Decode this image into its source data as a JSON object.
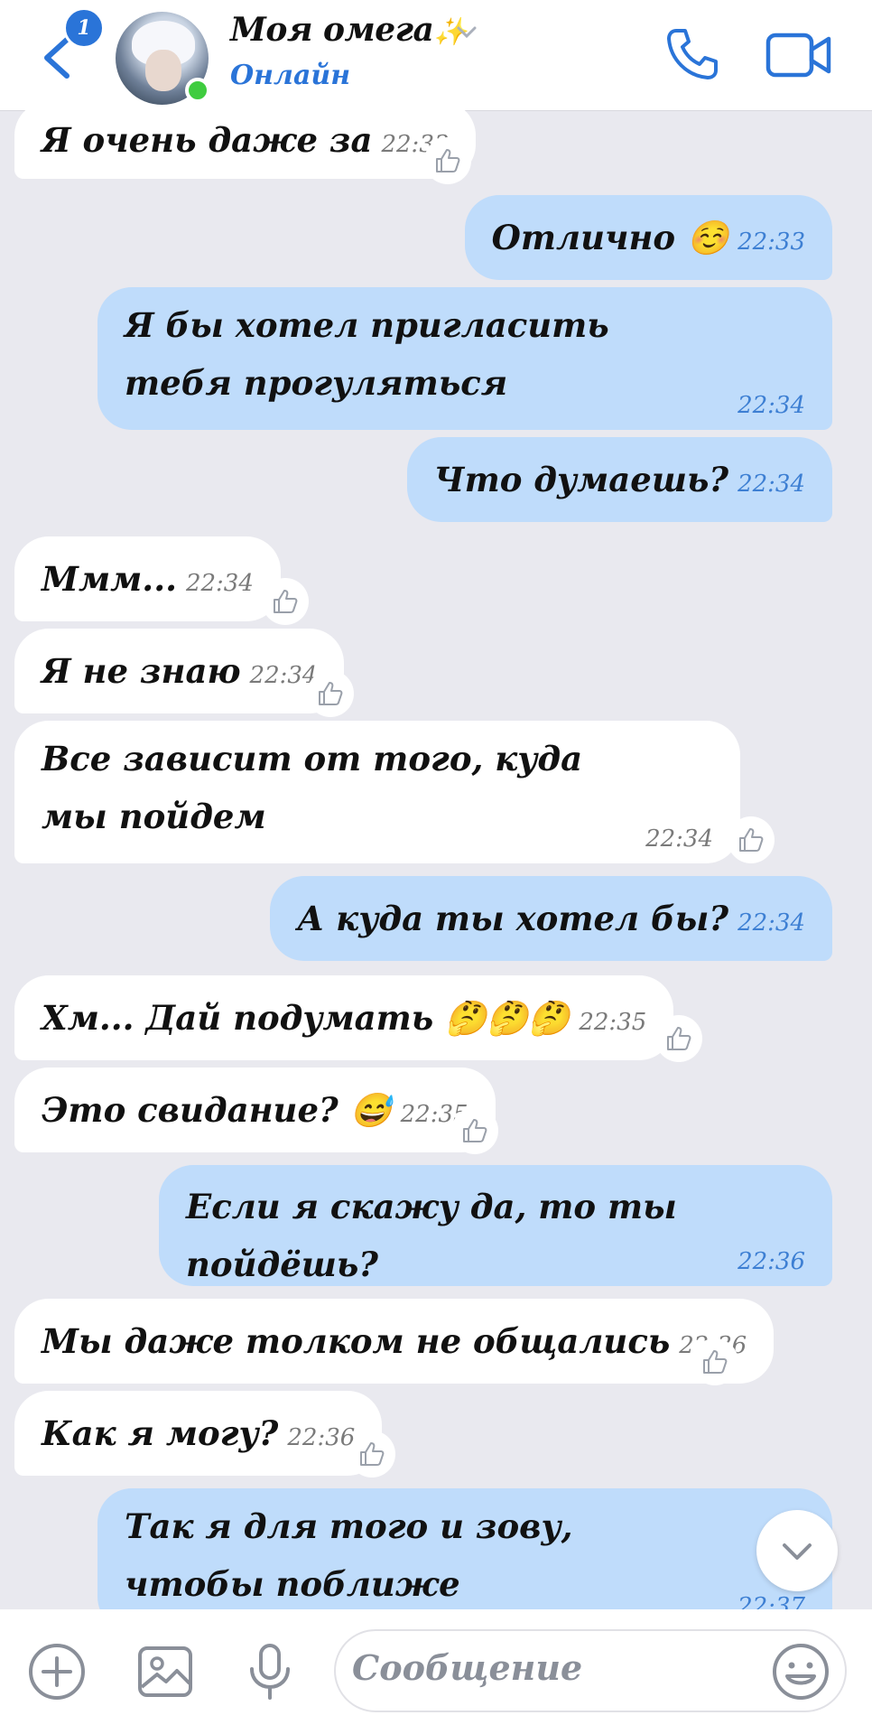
{
  "header": {
    "unread_badge": "1",
    "chat_title": "Моя омега",
    "title_emoji": "✨",
    "status": "Онлайн"
  },
  "messages": [
    {
      "side": "in",
      "text": "Я очень даже за",
      "time": "22:33"
    },
    {
      "side": "out",
      "text": "Отлично ☺️",
      "time": "22:33"
    },
    {
      "side": "out",
      "text": "Я бы хотел пригласить тебя прогуляться",
      "time": "22:34"
    },
    {
      "side": "out",
      "text": "Что думаешь?",
      "time": "22:34"
    },
    {
      "side": "in",
      "text": "Ммм...",
      "time": "22:34"
    },
    {
      "side": "in",
      "text": "Я не знаю",
      "time": "22:34"
    },
    {
      "side": "in",
      "text": "Все зависит от того, куда мы пойдем",
      "time": "22:34"
    },
    {
      "side": "out",
      "text": "А куда ты хотел бы?",
      "time": "22:34"
    },
    {
      "side": "in",
      "text": "Хм... Дай подумать 🤔🤔🤔",
      "time": "22:35"
    },
    {
      "side": "in",
      "text": "Это свидание? 😅",
      "time": "22:35"
    },
    {
      "side": "out",
      "text": "Если я скажу да, то ты пойдёшь?",
      "time": "22:36"
    },
    {
      "side": "in",
      "text": "Мы даже  толком не общались",
      "time": "22:36"
    },
    {
      "side": "in",
      "text": "Как я могу?",
      "time": "22:36"
    },
    {
      "side": "out",
      "text": "Так я для того и зову, чтобы поближе познакомится",
      "time": "22:37"
    }
  ],
  "composer": {
    "placeholder": "Сообщение"
  },
  "colors": {
    "accent": "#2a74d8",
    "outgoing_bubble": "#bfdcfb",
    "incoming_bubble": "#ffffff",
    "background": "#e9e9ef",
    "online": "#3fcc3f"
  },
  "icons": [
    "back-icon",
    "chevron-down-icon",
    "phone-icon",
    "video-camera-icon",
    "like-icon",
    "add-icon",
    "image-icon",
    "microphone-icon",
    "emoji-icon"
  ]
}
